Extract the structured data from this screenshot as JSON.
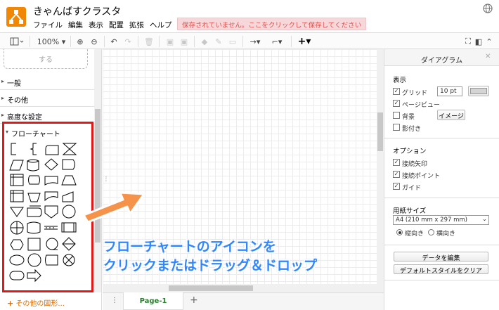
{
  "app": {
    "title": "きゃんばすクラスタ",
    "menu": [
      "ファイル",
      "編集",
      "表示",
      "配置",
      "拡張",
      "ヘルプ"
    ],
    "unsaved_notice": "保存されていません。ここをクリックして保存してください"
  },
  "toolbar": {
    "zoom": "100%"
  },
  "sidebar": {
    "drop_hint": "する",
    "sections": [
      "一般",
      "その他",
      "高度な設定",
      "フローチャート"
    ],
    "more_shapes": "その他の図形..."
  },
  "pages": {
    "tab": "Page-1"
  },
  "panel": {
    "title": "ダイアグラム",
    "view_heading": "表示",
    "grid_label": "グリッド",
    "grid_size": "10 pt",
    "page_view_label": "ページビュー",
    "background_label": "背景",
    "image_button": "イメージ",
    "shadow_label": "影付き",
    "options_heading": "オプション",
    "connection_arrows": "接続矢印",
    "connection_points": "接続ポイント",
    "guides": "ガイド",
    "paper_heading": "用紙サイズ",
    "paper_size": "A4 (210 mm x 297 mm)",
    "portrait": "縦向き",
    "landscape": "横向き",
    "edit_data": "データを編集",
    "clear_style": "デフォルトスタイルをクリア",
    "checks": {
      "grid": true,
      "page_view": true,
      "background": false,
      "shadow": false,
      "arrows": true,
      "points": true,
      "guides": true
    },
    "orientation": "portrait"
  },
  "annotation": {
    "line1": "フローチャートのアイコンを",
    "line2": "クリックまたはドラッグ＆ドロップ"
  },
  "colors": {
    "highlight": "#e01818",
    "annotation": "#2f86ff",
    "arrow": "#f5934a",
    "logo": "#f08705"
  }
}
